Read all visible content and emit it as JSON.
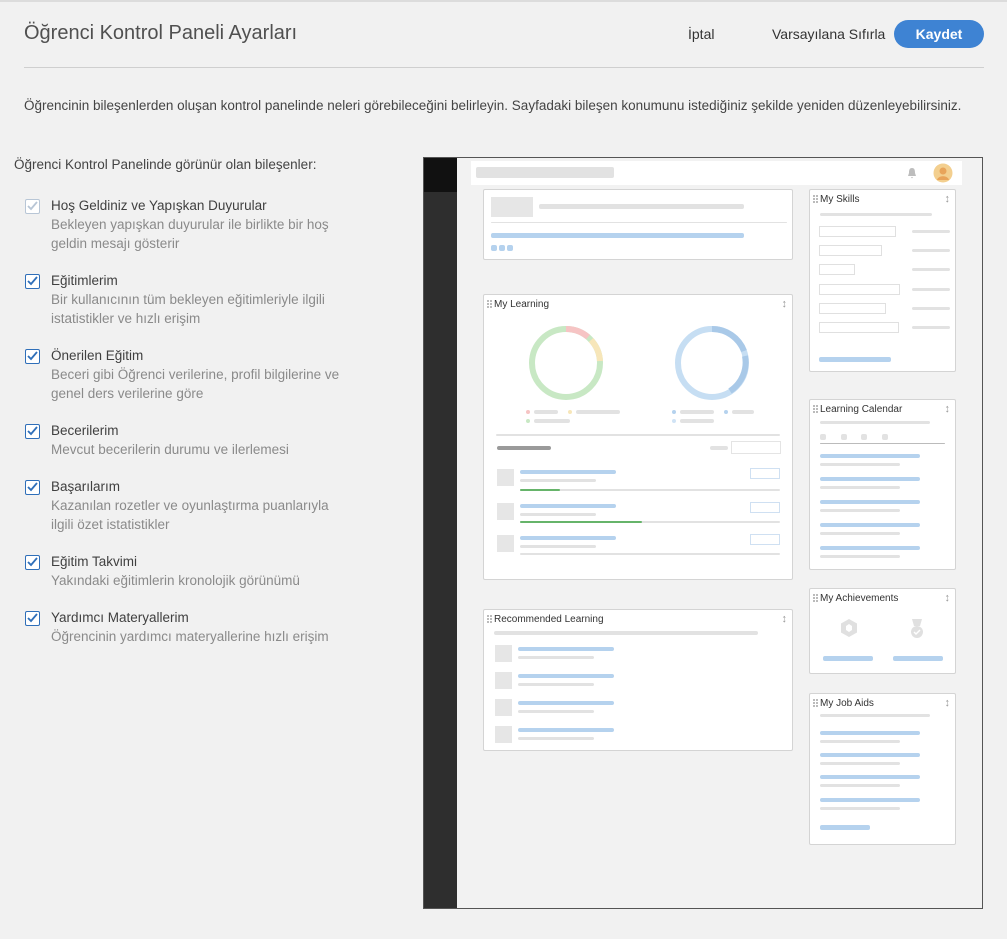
{
  "header": {
    "title": "Öğrenci Kontrol Paneli Ayarları",
    "cancel_label": "İptal",
    "reset_label": "Varsayılana Sıfırla",
    "save_label": "Kaydet"
  },
  "intro": "Öğrencinin bileşenlerden oluşan kontrol panelinde neleri görebileceğini belirleyin. Sayfadaki bileşen konumunu istediğiniz şekilde yeniden düzenleyebilirsiniz.",
  "section_title": "Öğrenci Kontrol Panelinde görünür olan bileşenler:",
  "options": [
    {
      "title": "Hoş Geldiniz ve Yapışkan Duyurular",
      "desc1": "Bekleyen yapışkan duyurular ile birlikte bir hoş",
      "desc2": "geldin mesajı gösterir",
      "checked": true,
      "disabled": true
    },
    {
      "title": "Eğitimlerim",
      "desc1": "Bir kullanıcının tüm bekleyen eğitimleriyle ilgili",
      "desc2": "istatistikler ve hızlı erişim",
      "checked": true,
      "disabled": false
    },
    {
      "title": "Önerilen Eğitim",
      "desc1": "Beceri gibi Öğrenci verilerine, profil bilgilerine ve",
      "desc2": "genel ders verilerine göre",
      "checked": true,
      "disabled": false
    },
    {
      "title": "Becerilerim",
      "desc1": "Mevcut becerilerin durumu ve ilerlemesi",
      "desc2": "",
      "checked": true,
      "disabled": false
    },
    {
      "title": "Başarılarım",
      "desc1": "Kazanılan rozetler ve oyunlaştırma puanlarıyla",
      "desc2": "ilgili özet istatistikler",
      "checked": true,
      "disabled": false
    },
    {
      "title": "Eğitim Takvimi",
      "desc1": "Yakındaki eğitimlerin kronolojik görünümü",
      "desc2": "",
      "checked": true,
      "disabled": false
    },
    {
      "title": "Yardımcı Materyallerim",
      "desc1": "Öğrencinin yardımcı materyallerine hızlı erişim",
      "desc2": "",
      "checked": true,
      "disabled": false
    }
  ],
  "preview": {
    "my_skills": "My Skills",
    "my_learning": "My Learning",
    "learning_calendar": "Learning Calendar",
    "my_achievements": "My Achievements",
    "recommended_learning": "Recommended Learning",
    "my_job_aids": "My Job Aids",
    "move_glyph": "↕"
  },
  "colors": {
    "accent": "#3e83d3",
    "checkbox": "#2f6fb9",
    "placeholder_blue": "#b5d2ee",
    "placeholder_gray": "#e2e2e2"
  }
}
